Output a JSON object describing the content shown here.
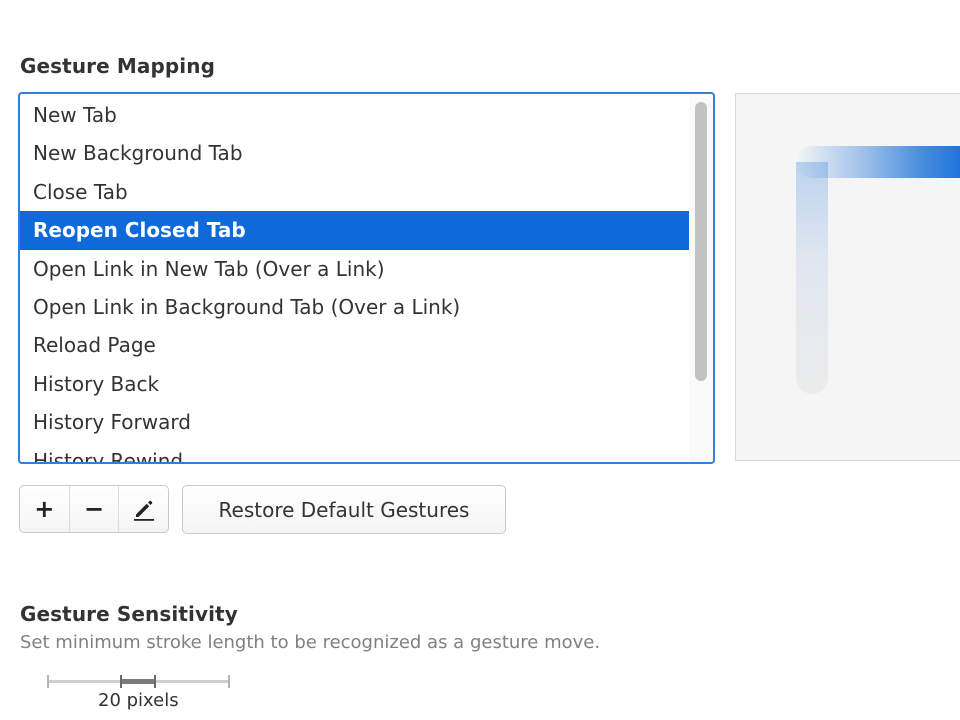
{
  "gesture_mapping": {
    "title": "Gesture Mapping",
    "items": [
      {
        "label": "New Tab",
        "selected": false
      },
      {
        "label": "New Background Tab",
        "selected": false
      },
      {
        "label": "Close Tab",
        "selected": false
      },
      {
        "label": "Reopen Closed Tab",
        "selected": true
      },
      {
        "label": "Open Link in New Tab (Over a Link)",
        "selected": false
      },
      {
        "label": "Open Link in Background Tab (Over a Link)",
        "selected": false
      },
      {
        "label": "Reload Page",
        "selected": false
      },
      {
        "label": "History Back",
        "selected": false
      },
      {
        "label": "History Forward",
        "selected": false
      },
      {
        "label": "History Rewind",
        "selected": false
      }
    ],
    "scroll_position": 0.0
  },
  "toolbar": {
    "add_label": "+",
    "remove_label": "−",
    "edit_icon": "pencil-icon",
    "restore_label": "Restore Default Gestures"
  },
  "gesture_sensitivity": {
    "title": "Gesture Sensitivity",
    "description": "Set minimum stroke length to be recognized as a gesture move.",
    "value_label": "20 pixels"
  },
  "colors": {
    "accent": "#0e6ad8",
    "focus_border": "#2f7ee0",
    "muted_text": "#808080"
  }
}
